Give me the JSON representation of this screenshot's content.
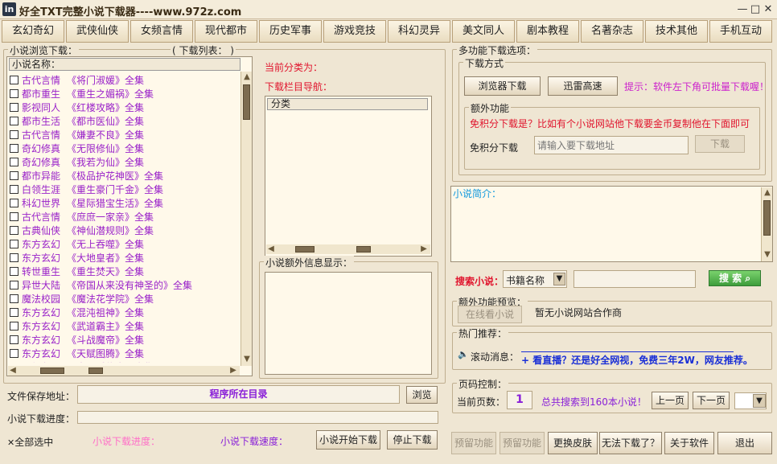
{
  "window": {
    "title": "好全TXT完整小说下载器----www.972z.com",
    "icon_text": "in",
    "controls": [
      "—",
      "□",
      "✕"
    ]
  },
  "categories": [
    "玄幻奇幻",
    "武侠仙侠",
    "女频言情",
    "现代都市",
    "历史军事",
    "游戏竞技",
    "科幻灵异",
    "美文同人",
    "剧本教程",
    "名著杂志",
    "技术其他",
    "手机互动"
  ],
  "left": {
    "browse_title": "小说浏览下载：",
    "download_list_title": "( 下载列表： )",
    "list_header": "小说名称：",
    "books": [
      {
        "category": "古代言情",
        "title": "《将门淑媛》全集"
      },
      {
        "category": "都市重生",
        "title": "《重生之媚祸》全集"
      },
      {
        "category": "影视同人",
        "title": "《红楼攻略》全集"
      },
      {
        "category": "都市生活",
        "title": "《都市医仙》全集"
      },
      {
        "category": "古代言情",
        "title": "《嫌妻不良》全集"
      },
      {
        "category": "奇幻修真",
        "title": "《无限修仙》全集"
      },
      {
        "category": "奇幻修真",
        "title": "《我若为仙》全集"
      },
      {
        "category": "都市异能",
        "title": "《极品护花神医》全集"
      },
      {
        "category": "白领生涯",
        "title": "《重生豪门千金》全集"
      },
      {
        "category": "科幻世界",
        "title": "《星际猎宝生活》全集"
      },
      {
        "category": "古代言情",
        "title": "《庶庶一家亲》全集"
      },
      {
        "category": "古典仙侠",
        "title": "《神仙潜规则》全集"
      },
      {
        "category": "东方玄幻",
        "title": "《无上吞噬》全集"
      },
      {
        "category": "东方玄幻",
        "title": "《大地皇者》全集"
      },
      {
        "category": "转世重生",
        "title": "《重生焚天》全集"
      },
      {
        "category": "异世大陆",
        "title": "《帝国从来没有神圣的》全集"
      },
      {
        "category": "魔法校园",
        "title": "《魔法花学院》全集"
      },
      {
        "category": "东方玄幻",
        "title": "《混沌祖神》全集"
      },
      {
        "category": "东方玄幻",
        "title": "《武道霸主》全集"
      },
      {
        "category": "东方玄幻",
        "title": "《斗战魔帝》全集"
      },
      {
        "category": "东方玄幻",
        "title": "《天赋图腾》全集"
      },
      {
        "category": "王朝争霸",
        "title": "《大公爵传奇》全集"
      }
    ],
    "save_path_label": "文件保存地址：",
    "save_path_value": "程序所在目录",
    "browse_button": "浏览",
    "progress_label": "小说下载进度：",
    "select_all": "全部选中",
    "progress_status": "小说下载进度：",
    "speed_status": "小说下载速度：",
    "start_button": "小说开始下载",
    "stop_button": "停止下载"
  },
  "middle": {
    "current_category": "当前分类为：",
    "nav_title": "下载栏目导航：",
    "nav_header": "分类",
    "extra_info_title": "小说额外信息显示："
  },
  "right": {
    "multi_title": "多功能下载选项：",
    "mode_title": "下载方式",
    "browser_download": "浏览器下载",
    "thunder_download": "迅雷高速",
    "tip": "提示：软件左下角可批量下载喔！",
    "extra_title": "额外功能",
    "free_notice": "免积分下载是？比如有个小说网站他下载要金币复制他在下面即可",
    "free_label": "免积分下载",
    "free_placeholder": "请输入要下载地址",
    "free_button": "下载",
    "intro_title": "小说简介：",
    "search_label": "搜索小说：",
    "search_type": "书籍名称",
    "search_button": "搜 索",
    "preview_title": "额外功能预览：",
    "online_read": "在线看小说",
    "partner_text": "暂无小说网站合作商",
    "hot_title": "热门推荐：",
    "scroll_label": "滚动消息：",
    "scroll_text": "+ 看直播？还是好全网视，免费三年2W，网友推荐。",
    "page_title": "页码控制：",
    "current_page_label": "当前页数：",
    "current_page": "1",
    "total_text": "总共搜索到160本小说！",
    "prev_page": "上一页",
    "next_page": "下一页"
  },
  "bottom_buttons": [
    "预留功能",
    "预留功能",
    "更换皮肤",
    "无法下载了？",
    "关于软件",
    "退出"
  ],
  "colors": {
    "background": "#efe6d3",
    "accent_purple": "#8a20d8",
    "accent_red": "#e0142d",
    "book_purple": "#9a22c9"
  }
}
